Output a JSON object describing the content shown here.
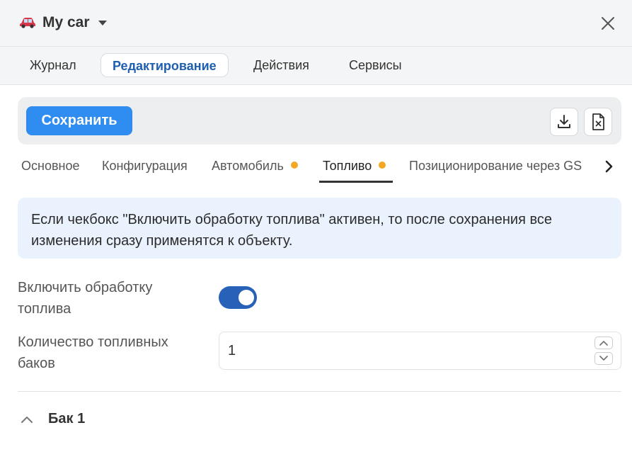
{
  "window": {
    "title": "My car",
    "car_icon": "car-icon",
    "close_icon": "close-icon"
  },
  "main_tabs": [
    {
      "label": "Журнал",
      "active": false
    },
    {
      "label": "Редактирование",
      "active": true
    },
    {
      "label": "Действия",
      "active": false
    },
    {
      "label": "Сервисы",
      "active": false
    }
  ],
  "toolbar": {
    "save_label": "Сохранить",
    "icons": [
      "download-icon",
      "delete-file-icon"
    ]
  },
  "sub_tabs": [
    {
      "label": "Основное",
      "dot": false,
      "active": false
    },
    {
      "label": "Конфигурация",
      "dot": false,
      "active": false
    },
    {
      "label": "Автомобиль",
      "dot": true,
      "active": false
    },
    {
      "label": "Топливо",
      "dot": true,
      "active": true
    },
    {
      "label": "Позиционирование через GSM",
      "dot": false,
      "active": false
    }
  ],
  "info": {
    "text": "Если чекбокс \"Включить обработку топлива\" активен, то после сохранения все изменения сразу применятся к объекту."
  },
  "form": {
    "fuel_processing_label": "Включить обработку топлива",
    "fuel_processing_enabled": true,
    "tank_count_label": "Количество топливных баков",
    "tank_count_value": "1"
  },
  "sections": [
    {
      "title": "Бак 1",
      "expanded": true
    }
  ],
  "colors": {
    "accent": "#2f8cf0",
    "toggle_on": "#2761b8",
    "dot": "#f5a623",
    "info_bg": "#eaf3fd"
  }
}
